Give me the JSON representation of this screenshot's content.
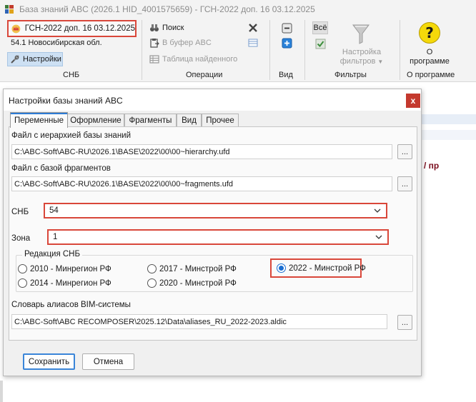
{
  "app": {
    "title": "База знаний ABC (2026.1 HID_4001575659) - ГСН-2022 доп. 16 03.12.2025"
  },
  "ribbon": {
    "snb": {
      "current": "ГСН-2022 доп. 16 03.12.2025",
      "region": "54.1 Новосибирская обл.",
      "settings_label": "Настройки",
      "group_label": "СНБ"
    },
    "operations": {
      "search_label": "Поиск",
      "buffer_label": "В буфер ABC",
      "found_table_label": "Таблица найденного",
      "group_label": "Операции"
    },
    "view": {
      "group_label": "Вид"
    },
    "filters": {
      "all_label": "Всё",
      "settings_label_line1": "Настройка",
      "settings_label_line2": "фильтров",
      "group_label": "Фильтры"
    },
    "about": {
      "button_label_line1": "О",
      "button_label_line2": "программе",
      "group_label": "О программе"
    }
  },
  "background": {
    "fragment_text": "/ пр"
  },
  "dialog": {
    "title": "Настройки базы знаний ABC",
    "close_label": "x",
    "tabs": [
      {
        "label": "Переменные",
        "active": true
      },
      {
        "label": "Оформление",
        "active": false
      },
      {
        "label": "Фрагменты",
        "active": false
      },
      {
        "label": "Вид",
        "active": false
      },
      {
        "label": "Прочее",
        "active": false
      }
    ],
    "hierarchy_file": {
      "label": "Файл с иерархией базы знаний",
      "value": "C:\\ABC-Soft\\ABC-RU\\2026.1\\BASE\\2022\\00\\00~hierarchy.ufd",
      "browse_label": "..."
    },
    "fragments_file": {
      "label": "Файл с базой фрагментов",
      "value": "C:\\ABC-Soft\\ABC-RU\\2026.1\\BASE\\2022\\00\\00~fragments.ufd",
      "browse_label": "..."
    },
    "snb": {
      "label": "СНБ",
      "value": "54"
    },
    "zone": {
      "label": "Зона",
      "value": "1"
    },
    "edition": {
      "title": "Редакция СНБ",
      "options": [
        {
          "label": "2010 - Минрегион РФ",
          "selected": false
        },
        {
          "label": "2017 - Минстрой РФ",
          "selected": false
        },
        {
          "label": "2022 - Минстрой РФ",
          "selected": true
        },
        {
          "label": "2014 - Минрегион РФ",
          "selected": false
        },
        {
          "label": "2020 - Минстрой РФ",
          "selected": false
        }
      ]
    },
    "bim_dictionary": {
      "label": "Словарь алиасов BIM-системы",
      "value": "C:\\ABC-Soft\\ABC RECOMPOSER\\2025.12\\Data\\aliases_RU_2022-2023.aldic",
      "browse_label": "..."
    },
    "save_label": "Сохранить",
    "cancel_label": "Отмена"
  },
  "colors": {
    "highlight": "#d9473a",
    "accent": "#2e7bd4",
    "close_button": "#c4392e"
  }
}
